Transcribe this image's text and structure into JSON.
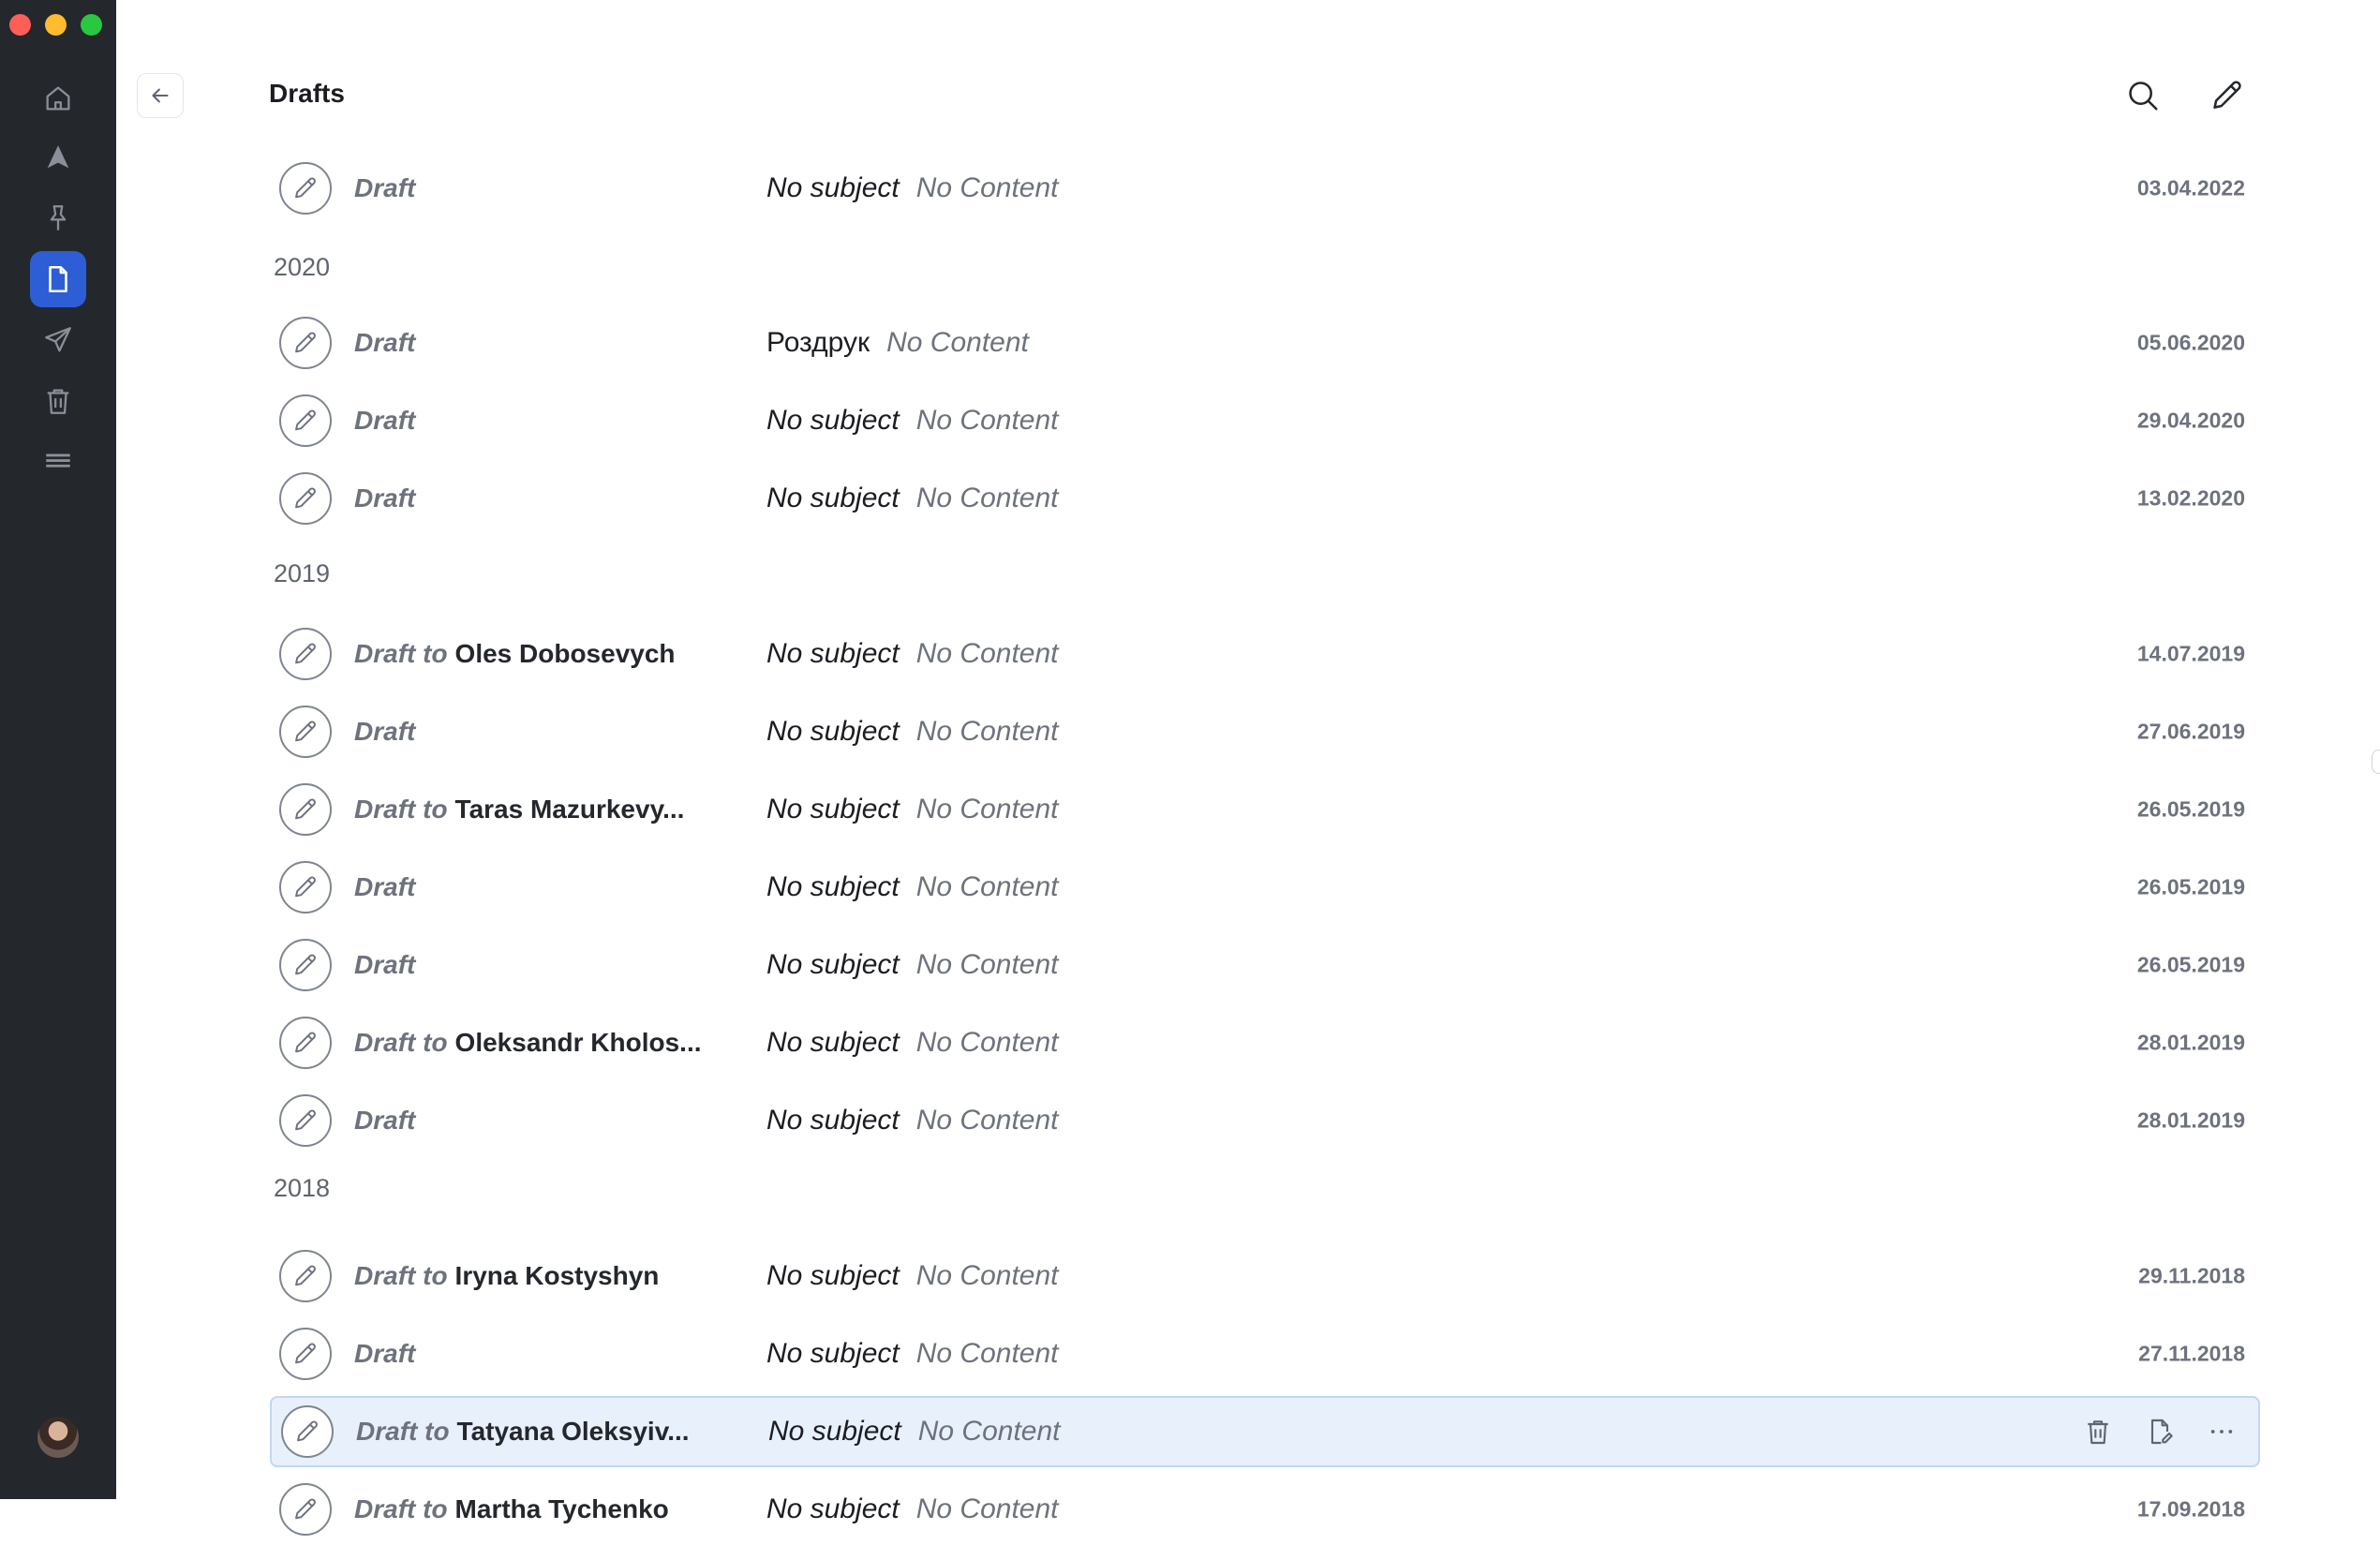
{
  "window": {
    "controls": [
      "close",
      "minimize",
      "zoom"
    ]
  },
  "sidebar": {
    "items": [
      {
        "name": "home",
        "icon": "home-icon"
      },
      {
        "name": "important",
        "icon": "send-arrow-icon"
      },
      {
        "name": "pinned",
        "icon": "pin-icon"
      },
      {
        "name": "drafts",
        "icon": "document-icon",
        "active": true
      },
      {
        "name": "sent",
        "icon": "paper-plane-icon"
      },
      {
        "name": "trash",
        "icon": "trash-icon"
      },
      {
        "name": "menu",
        "icon": "hamburger-icon"
      }
    ],
    "active_color": "#2e5ed6",
    "background": "#24272c"
  },
  "header": {
    "title": "Drafts"
  },
  "labels": {
    "draft": "Draft",
    "draft_to": "Draft to",
    "no_subject": "No subject",
    "no_content": "No Content"
  },
  "years": [
    "2020",
    "2019",
    "2018"
  ],
  "drafts": [
    {
      "recipient": "",
      "subject": "No subject",
      "preview": "No Content",
      "date": "03.04.2022"
    },
    {
      "recipient": "",
      "subject": "Роздрук",
      "preview": "No Content",
      "date": "05.06.2020"
    },
    {
      "recipient": "",
      "subject": "No subject",
      "preview": "No Content",
      "date": "29.04.2020"
    },
    {
      "recipient": "",
      "subject": "No subject",
      "preview": "No Content",
      "date": "13.02.2020"
    },
    {
      "recipient": "Oles Dobosevych",
      "subject": "No subject",
      "preview": "No Content",
      "date": "14.07.2019"
    },
    {
      "recipient": "",
      "subject": "No subject",
      "preview": "No Content",
      "date": "27.06.2019"
    },
    {
      "recipient": "Taras Mazurkevy...",
      "subject": "No subject",
      "preview": "No Content",
      "date": "26.05.2019"
    },
    {
      "recipient": "",
      "subject": "No subject",
      "preview": "No Content",
      "date": "26.05.2019"
    },
    {
      "recipient": "",
      "subject": "No subject",
      "preview": "No Content",
      "date": "26.05.2019"
    },
    {
      "recipient": "Oleksandr Kholos...",
      "subject": "No subject",
      "preview": "No Content",
      "date": "28.01.2019"
    },
    {
      "recipient": "",
      "subject": "No subject",
      "preview": "No Content",
      "date": "28.01.2019"
    },
    {
      "recipient": "Iryna Kostyshyn",
      "subject": "No subject",
      "preview": "No Content",
      "date": "29.11.2018"
    },
    {
      "recipient": "",
      "subject": "No subject",
      "preview": "No Content",
      "date": "27.11.2018"
    },
    {
      "recipient": "Tatyana Oleksyiv...",
      "subject": "No subject",
      "preview": "No Content",
      "date": "",
      "selected": true
    },
    {
      "recipient": "Martha Tychenko",
      "subject": "No subject",
      "preview": "No Content",
      "date": "17.09.2018"
    }
  ],
  "row_actions": [
    {
      "icon": "trash-icon"
    },
    {
      "icon": "edit-document-icon"
    },
    {
      "icon": "more-icon"
    }
  ]
}
